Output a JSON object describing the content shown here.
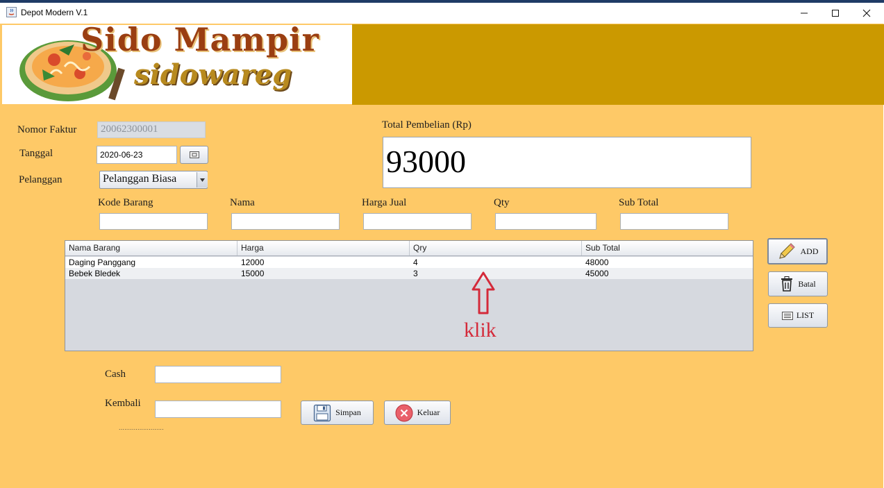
{
  "window": {
    "title": "Depot Modern V.1"
  },
  "logo": {
    "line1": "Sido Mampir",
    "line2": "sidowareg"
  },
  "invoice": {
    "label": "Nomor Faktur",
    "value": "20062300001"
  },
  "date": {
    "label": "Tanggal",
    "value": "2020-06-23"
  },
  "customer": {
    "label": "Pelanggan",
    "selected": "Pelanggan Biasa"
  },
  "total": {
    "label": "Total Pembelian (Rp)",
    "value": "93000"
  },
  "entry": {
    "kode_label": "Kode Barang",
    "nama_label": "Nama",
    "harga_label": "Harga Jual",
    "qty_label": "Qty",
    "subtotal_label": "Sub Total"
  },
  "table": {
    "columns": [
      "Nama Barang",
      "Harga",
      "Qry",
      "Sub Total"
    ],
    "rows": [
      [
        "Daging Panggang",
        "12000",
        "4",
        "48000"
      ],
      [
        "Bebek Bledek",
        "15000",
        "3",
        "45000"
      ]
    ]
  },
  "buttons": {
    "add": "ADD",
    "batal": "Batal",
    "list": "LIST",
    "simpan": "Simpan",
    "keluar": "Keluar"
  },
  "payment": {
    "cash_label": "Cash",
    "kembali_label": "Kembali",
    "dots": "........................"
  },
  "annotation": {
    "text": "klik",
    "color": "#d42a3a"
  },
  "colors": {
    "background": "#fec967",
    "banner": "#cb9900"
  }
}
